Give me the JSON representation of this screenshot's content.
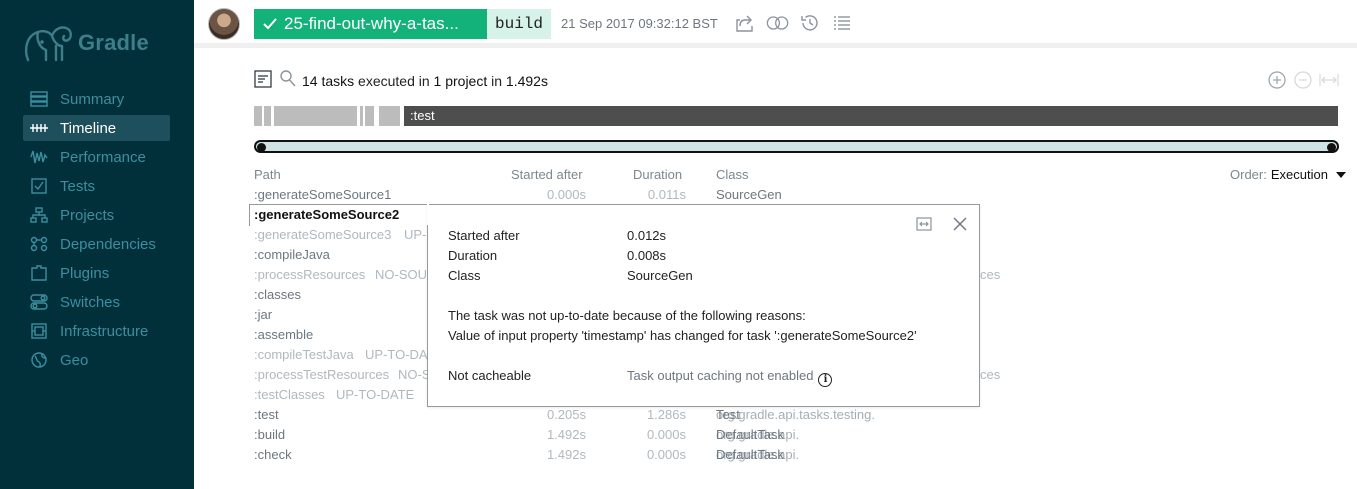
{
  "sidebar": {
    "logo_text": "Gradle",
    "items": [
      {
        "label": "Summary",
        "icon": "summary-icon"
      },
      {
        "label": "Timeline",
        "icon": "timeline-icon",
        "active": true
      },
      {
        "label": "Performance",
        "icon": "performance-icon"
      },
      {
        "label": "Tests",
        "icon": "tests-icon"
      },
      {
        "label": "Projects",
        "icon": "projects-icon"
      },
      {
        "label": "Dependencies",
        "icon": "dependencies-icon"
      },
      {
        "label": "Plugins",
        "icon": "plugins-icon"
      },
      {
        "label": "Switches",
        "icon": "switches-icon"
      },
      {
        "label": "Infrastructure",
        "icon": "infrastructure-icon"
      },
      {
        "label": "Geo",
        "icon": "geo-icon"
      }
    ]
  },
  "topbar": {
    "build_name": "25-find-out-why-a-tas...",
    "tag": "build",
    "datetime": "21 Sep 2017 09:32:12 BST",
    "icons": [
      "share-icon",
      "compare-icon",
      "history-icon",
      "list-icon"
    ]
  },
  "summary": {
    "tasks": "14 tasks",
    "executed_in": "executed in",
    "projects": "1 project",
    "in": "in",
    "duration": "1.492s"
  },
  "timeline": {
    "test_label": ":test"
  },
  "table": {
    "headers": {
      "path": "Path",
      "started_after": "Started after",
      "duration": "Duration",
      "class": "Class"
    },
    "order_label": "Order:",
    "order_value": "Execution",
    "rows": [
      {
        "path": ":generateSomeSource1",
        "started": "0.000s",
        "duration": "0.011s",
        "class_pkg": "",
        "class_name": "SourceGen"
      },
      {
        "path": ":generateSomeSource2",
        "status": "",
        "selected": true
      },
      {
        "path": ":generateSomeSource3",
        "status": "UP-"
      },
      {
        "path": ":compileJava",
        "status": ""
      },
      {
        "path": ":processResources",
        "status": "NO-SOU"
      },
      {
        "path": ":classes",
        "status": ""
      },
      {
        "path": ":jar",
        "status": ""
      },
      {
        "path": ":assemble",
        "status": ""
      },
      {
        "path": ":compileTestJava",
        "status": "UP-TO-DA"
      },
      {
        "path": ":processTestResources",
        "status": "NO-S"
      },
      {
        "path": ":testClasses",
        "status": "UP-TO-DATE"
      },
      {
        "path": ":test",
        "started": "0.205s",
        "duration": "1.286s",
        "class_pkg": "org.gradle.api.tasks.testing.",
        "class_name": "Test"
      },
      {
        "path": ":build",
        "started": "1.492s",
        "duration": "0.000s",
        "class_pkg": "org.gradle.api.",
        "class_name": "DefaultTask"
      },
      {
        "path": ":check",
        "started": "1.492s",
        "duration": "0.000s",
        "class_pkg": "org.gradle.api.",
        "class_name": "DefaultTask"
      }
    ],
    "ghost_right": [
      "ces",
      "ces"
    ]
  },
  "popup": {
    "started_label": "Started after",
    "started_value": "0.012s",
    "duration_label": "Duration",
    "duration_value": "0.008s",
    "class_label": "Class",
    "class_value": "SourceGen",
    "reason_heading": "The task was not up-to-date because of the following reasons:",
    "reason_detail": "Value of input property 'timestamp' has changed for task ':generateSomeSource2'",
    "cache_label": "Not cacheable",
    "cache_value": "Task output caching not enabled",
    "info_glyph": "i"
  }
}
